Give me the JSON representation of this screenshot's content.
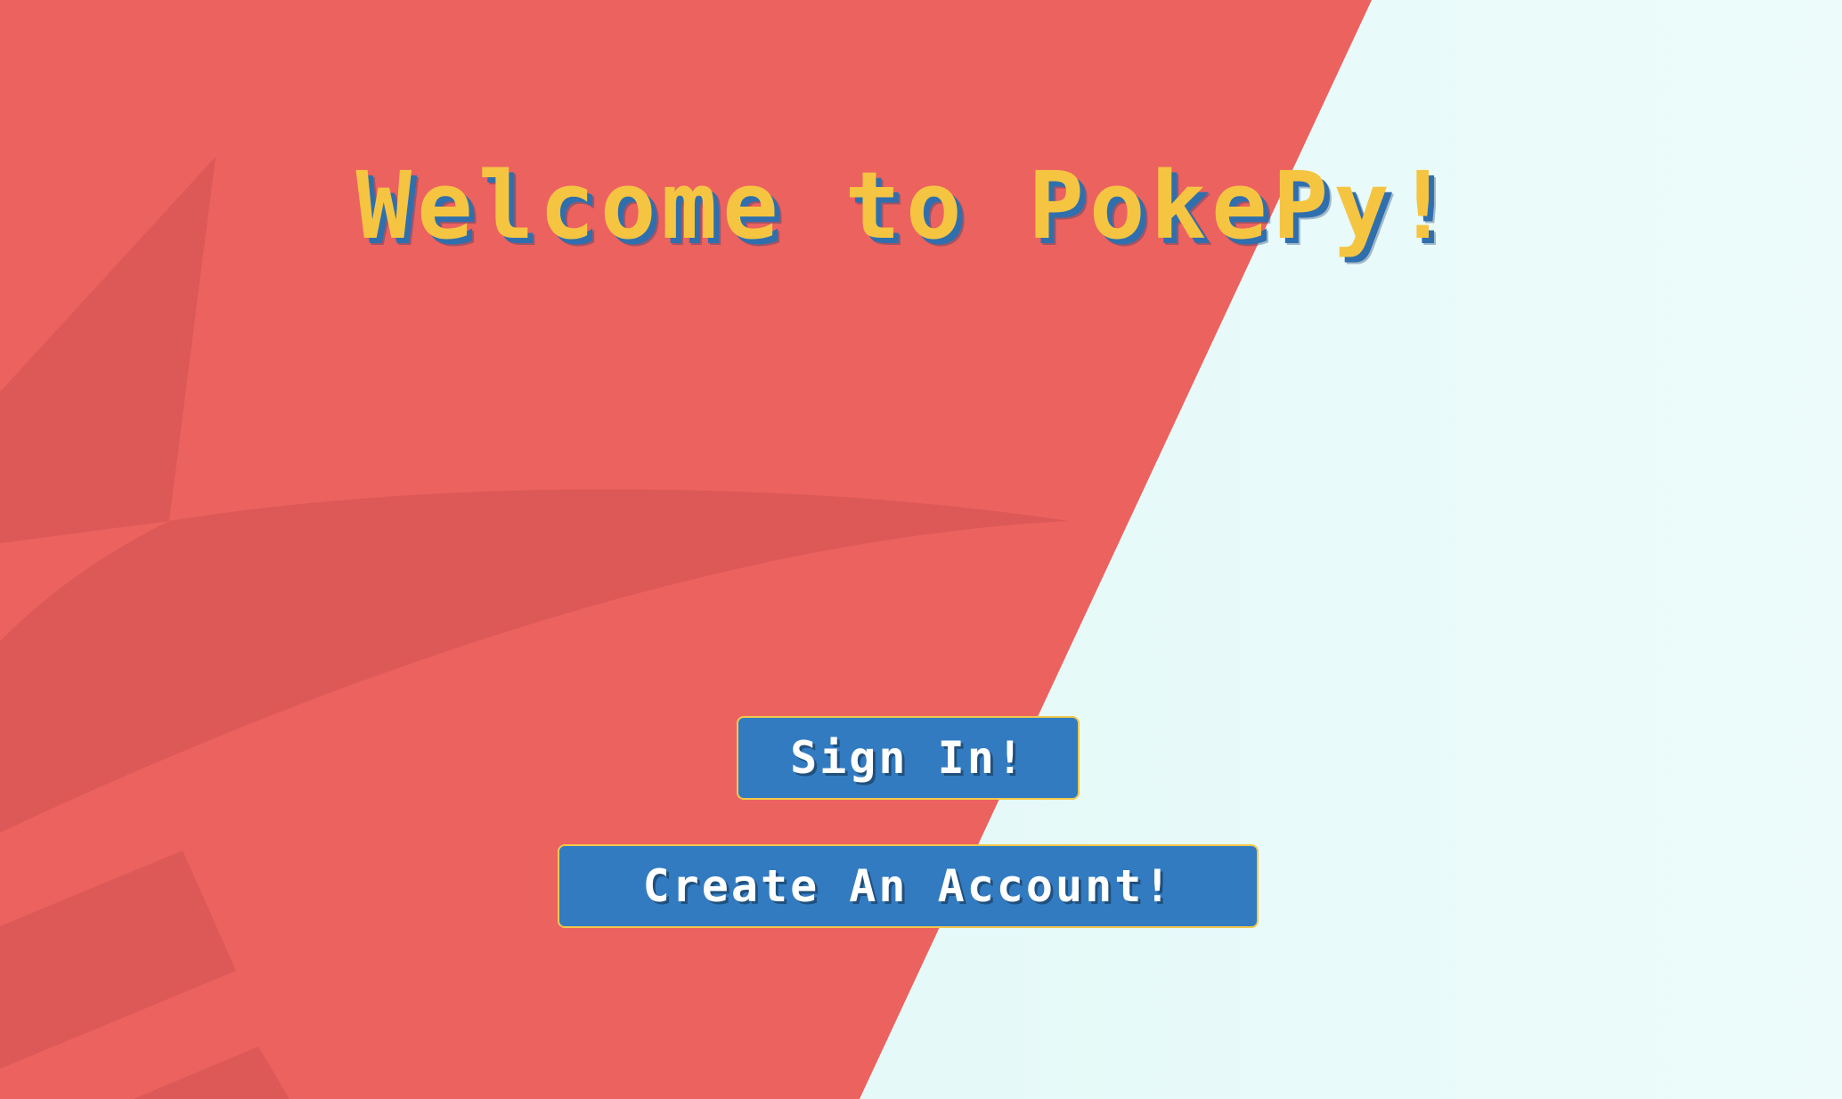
{
  "page": {
    "title": "Welcome to PokePy!"
  },
  "actions": {
    "sign_in_label": "Sign In!",
    "create_account_label": "Create An Account!"
  },
  "colors": {
    "background_red": "#ec625f",
    "background_mint": "#e9fbfa",
    "title_yellow": "#f5c542",
    "button_blue": "#327bc1",
    "button_border": "#f2c84b"
  }
}
